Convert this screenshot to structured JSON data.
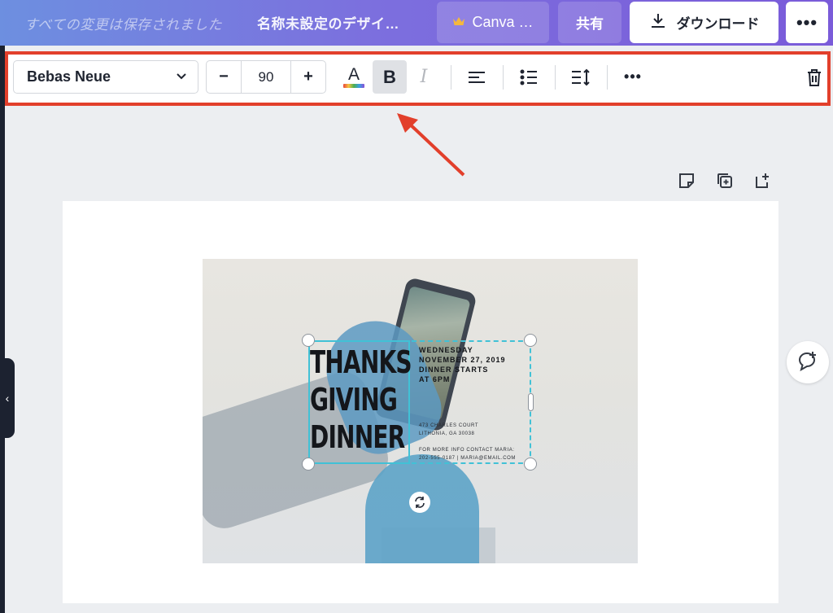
{
  "topbar": {
    "save_status": "すべての変更は保存されました",
    "doc_title": "名称未設定のデザイ…",
    "canva_button": "Canva …",
    "share_button": "共有",
    "download_button": "ダウンロード",
    "more_symbol": "•••"
  },
  "toolbar": {
    "font_name": "Bebas Neue",
    "font_size": "90",
    "minus": "−",
    "plus": "+",
    "color_letter": "A",
    "bold_label": "B",
    "italic_label": "I",
    "more_symbol": "•••"
  },
  "design": {
    "title_lines": [
      "THANKS",
      "GIVING",
      "DINNER"
    ],
    "info_top": [
      "WEDNESDAY",
      "NOVEMBER 27, 2019",
      "DINNER STARTS",
      "AT 6PM"
    ],
    "info_bottom": [
      "473 CHARLES COURT",
      "LITHONIA, GA 30038",
      "",
      "FOR MORE INFO CONTACT MARIA:",
      "202-555-0187 | MARIA@EMAIL.COM"
    ]
  },
  "left_panel": {
    "collapse_symbol": "‹"
  },
  "colors": {
    "annotation_red": "#e23f2b",
    "selection_cyan": "#41c1d6",
    "topbar_start": "#6d8fe0",
    "topbar_end": "#7a5bd9"
  }
}
